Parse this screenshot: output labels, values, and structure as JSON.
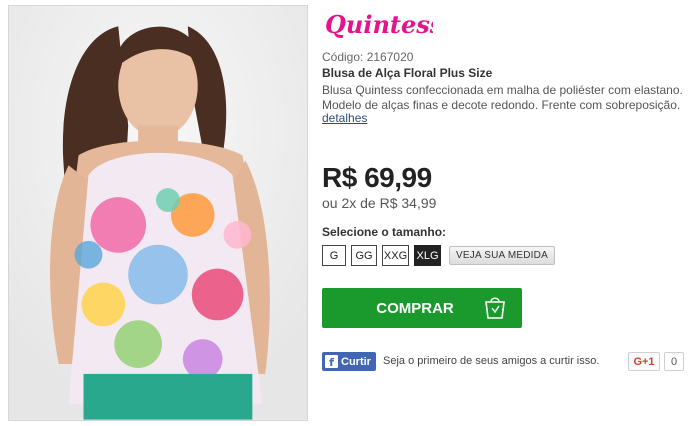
{
  "brand": {
    "name": "Quintess",
    "color": "#e5148a"
  },
  "product": {
    "code": "Código: 2167020",
    "name": "Blusa de Alça Floral Plus Size",
    "description_lines": [
      "Blusa Quintess confeccionada em malha de poliéster com elastano.",
      "Modelo de alças finas e decote redondo. Frente com sobreposição."
    ],
    "details_link": "detalhes",
    "price": "R$ 69,99",
    "installments": "ou 2x de R$ 34,99",
    "image_alt": "model-wearing-floral-tank-top"
  },
  "sizes": {
    "heading": "Selecione o tamanho:",
    "options": [
      "G",
      "GG",
      "XXG",
      "XLG"
    ],
    "selected": "XLG",
    "measure_label": "VEJA SUA MEDIDA"
  },
  "buy": {
    "label": "COMPRAR",
    "icon": "shopping-bag-icon",
    "color": "#1a9a2c"
  },
  "social": {
    "fb_like_label": "Curtir",
    "fb_text": "Seja o primeiro de seus amigos a curtir isso.",
    "gplus_label": "G+1",
    "gplus_count": "0",
    "fb_color": "#4267b2"
  }
}
